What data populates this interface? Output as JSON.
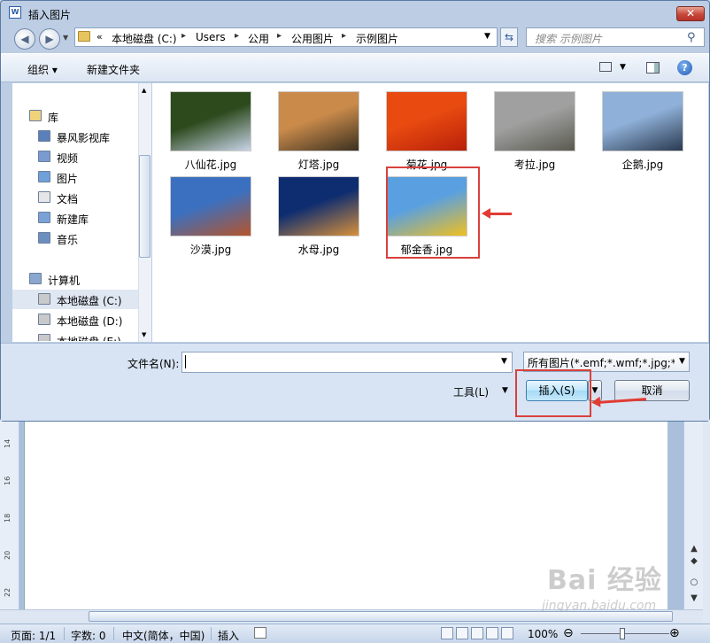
{
  "dialog": {
    "title": "插入图片",
    "close_label": "✕"
  },
  "nav": {
    "back": "◀",
    "forward": "▶",
    "breadcrumb_prefix": "«",
    "breadcrumbs": [
      "本地磁盘 (C:)",
      "Users",
      "公用",
      "公用图片",
      "示例图片"
    ],
    "search_placeholder": "搜索 示例图片"
  },
  "toolbar": {
    "organize": "组织 ▾",
    "new_folder": "新建文件夹"
  },
  "sidebar": {
    "items": [
      {
        "label": "库",
        "icon": "library-icon"
      },
      {
        "label": "暴风影视库",
        "icon": "video-library-icon"
      },
      {
        "label": "视频",
        "icon": "video-icon"
      },
      {
        "label": "图片",
        "icon": "picture-icon"
      },
      {
        "label": "文档",
        "icon": "document-icon"
      },
      {
        "label": "新建库",
        "icon": "new-library-icon"
      },
      {
        "label": "音乐",
        "icon": "music-icon"
      },
      {
        "label": "计算机",
        "icon": "computer-icon"
      },
      {
        "label": "本地磁盘 (C:)",
        "icon": "drive-icon",
        "selected": true
      },
      {
        "label": "本地磁盘 (D:)",
        "icon": "drive-icon"
      },
      {
        "label": "本地磁盘 (E:)",
        "icon": "drive-icon"
      }
    ]
  },
  "files": [
    {
      "name": "八仙花.jpg",
      "colors": [
        "#2c4a1c",
        "#c9d4e8"
      ]
    },
    {
      "name": "灯塔.jpg",
      "colors": [
        "#c98a4a",
        "#3b3020"
      ]
    },
    {
      "name": "菊花.jpg",
      "colors": [
        "#e84a10",
        "#b8200a"
      ]
    },
    {
      "name": "考拉.jpg",
      "colors": [
        "#a0a0a0",
        "#5a5a50"
      ]
    },
    {
      "name": "企鹅.jpg",
      "colors": [
        "#8fb0d8",
        "#2a3a50"
      ]
    },
    {
      "name": "沙漠.jpg",
      "colors": [
        "#3b70c0",
        "#b5542a"
      ]
    },
    {
      "name": "水母.jpg",
      "colors": [
        "#0e2d70",
        "#d8903a"
      ]
    },
    {
      "name": "郁金香.jpg",
      "colors": [
        "#5aa0e0",
        "#f0c020"
      ],
      "highlighted": true
    }
  ],
  "footer": {
    "filename_label": "文件名(N):",
    "filename_value": "",
    "filter": "所有图片(*.emf;*.wmf;*.jpg;*.jp",
    "tools": "工具(L)",
    "insert": "插入(S)",
    "cancel": "取消"
  },
  "word": {
    "ruler_marks": [
      "14",
      "16",
      "18",
      "20",
      "22"
    ],
    "status": {
      "page": "页面: 1/1",
      "words": "字数: 0",
      "language": "中文(简体，中国)",
      "mode": "插入",
      "zoom": "100%"
    }
  },
  "watermark": {
    "logo": "Bai 经验",
    "url": "jingyan.baidu.com"
  },
  "accent_colors": {
    "annotation_red": "#d9403c",
    "selection": "#dfe7f2"
  }
}
